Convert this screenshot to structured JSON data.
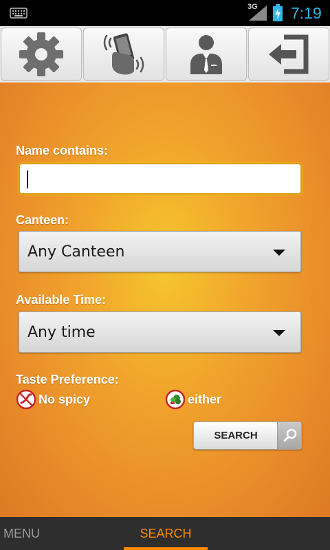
{
  "status_bar": {
    "network_type": "3G",
    "time": "7:19",
    "icons": [
      "keyboard-icon",
      "signal-icon",
      "battery-charging-icon"
    ],
    "accent_color": "#33b5e5"
  },
  "toolbar": {
    "buttons": [
      {
        "icon": "gear-icon"
      },
      {
        "icon": "shake-phone-icon"
      },
      {
        "icon": "person-icon"
      },
      {
        "icon": "logout-icon"
      }
    ]
  },
  "form": {
    "name_label": "Name contains:",
    "name_value": "",
    "canteen_label": "Canteen:",
    "canteen_value": "Any Canteen",
    "time_label": "Available Time:",
    "time_value": "Any time",
    "taste_label": "Taste Preference:",
    "taste_options": [
      {
        "label": "No spicy",
        "icon": "no-spicy-icon"
      },
      {
        "label": "either",
        "icon": "vegetable-icon"
      }
    ],
    "search_button": "SEARCH"
  },
  "tabs": {
    "items": [
      {
        "label": "MENU",
        "active": false
      },
      {
        "label": "SEARCH",
        "active": true
      }
    ],
    "active_color": "#ff8a00"
  }
}
